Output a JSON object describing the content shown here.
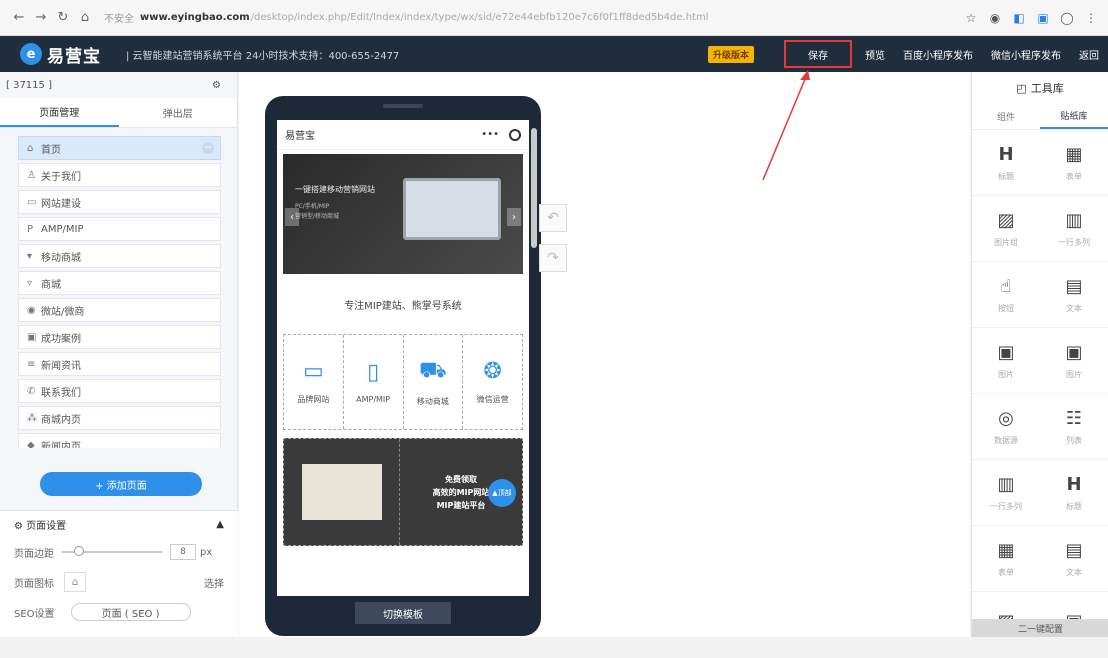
{
  "browser": {
    "security_label": "不安全",
    "host": "www.eyingbao.com",
    "path": "/desktop/index.php/Edit/Index/index/type/wx/sid/e72e44ebfb120e7c6f0f1ff8ded5b4de.html"
  },
  "header": {
    "logo_mark": "e",
    "logo_text": "易营宝",
    "slogan": "| 云智能建站营销系统平台 24小时技术支持：400-655-2477",
    "badge": "升级版本",
    "items": [
      "保存",
      "预览",
      "百度小程序发布",
      "微信小程序发布",
      "返回"
    ]
  },
  "left": {
    "site_id": "[ 37115 ]",
    "tabs": [
      "页面管理",
      "弹出层"
    ],
    "pages": [
      {
        "icon": "home-icon",
        "glyph": "⌂",
        "label": "首页"
      },
      {
        "icon": "about-icon",
        "glyph": "♙",
        "label": "关于我们"
      },
      {
        "icon": "site-icon",
        "glyph": "▭",
        "label": "网站建设"
      },
      {
        "icon": "amp-icon",
        "glyph": "P",
        "label": "AMP/MIP"
      },
      {
        "icon": "mobile-icon",
        "glyph": "▾",
        "label": "移动商城"
      },
      {
        "icon": "mall-icon",
        "glyph": "▿",
        "label": "商城"
      },
      {
        "icon": "wechat-icon",
        "glyph": "◉",
        "label": "微站/微商"
      },
      {
        "icon": "case-icon",
        "glyph": "▣",
        "label": "成功案例"
      },
      {
        "icon": "news-icon",
        "glyph": "≡",
        "label": "新闻资讯"
      },
      {
        "icon": "contact-icon",
        "glyph": "✆",
        "label": "联系我们"
      },
      {
        "icon": "grid-icon",
        "glyph": "⁂",
        "label": "商城内页"
      },
      {
        "icon": "inner-icon",
        "glyph": "◆",
        "label": "新闻内页"
      }
    ],
    "add_page": "+ 添加页面",
    "settings": {
      "title": "页面设置",
      "margin_label": "页面边距",
      "margin_value": "8",
      "margin_unit": "px",
      "icon_label": "页面图标",
      "icon_action": "选择",
      "seo_label": "SEO设置",
      "seo_value": "页面 ( SEO )"
    }
  },
  "phone": {
    "site_name": "易营宝",
    "banner_title": "一键搭建移动营销网站",
    "banner_sub": "PC/手机/MIP\n营销型/移动商城",
    "tagline": "专注MIP建站、熊掌号系统",
    "features": [
      {
        "glyph": "▭",
        "icon": "laptop-icon",
        "label": "品牌网站"
      },
      {
        "glyph": "▯",
        "icon": "phone-icon",
        "label": "AMP/MIP"
      },
      {
        "glyph": "⛟",
        "icon": "cart-icon",
        "label": "移动商城"
      },
      {
        "glyph": "❂",
        "icon": "wechat-icon",
        "label": "微信运营"
      }
    ],
    "promo_lines": [
      "免费领取",
      "高效的MIP网站",
      "MIP建站平台"
    ],
    "fab_label": "顶部",
    "switch_template": "切换模板"
  },
  "right": {
    "title": "工具库",
    "tabs": [
      "组件",
      "贴纸库"
    ],
    "widgets": [
      {
        "glyph": "H",
        "icon": "heading-icon",
        "label": "标题"
      },
      {
        "glyph": "▦",
        "icon": "form-icon",
        "label": "表单"
      },
      {
        "glyph": "▨",
        "icon": "image-group-icon",
        "label": "图片组"
      },
      {
        "glyph": "▥",
        "icon": "columns-icon",
        "label": "一行多列"
      },
      {
        "glyph": "☝",
        "icon": "click-icon",
        "label": "按钮"
      },
      {
        "glyph": "▤",
        "icon": "text-icon",
        "label": "文本"
      },
      {
        "glyph": "▣",
        "icon": "picture-icon",
        "label": "图片"
      },
      {
        "glyph": "▣",
        "icon": "picture-icon-2",
        "label": "图片"
      },
      {
        "glyph": "◎",
        "icon": "database-icon",
        "label": "数据源"
      },
      {
        "glyph": "☷",
        "icon": "list-icon",
        "label": "列表"
      },
      {
        "glyph": "▥",
        "icon": "columns-icon-2",
        "label": "一行多列"
      },
      {
        "glyph": "H",
        "icon": "heading-icon-2",
        "label": "标题"
      },
      {
        "glyph": "▦",
        "icon": "form-icon-2",
        "label": "表单"
      },
      {
        "glyph": "▤",
        "icon": "text-icon-2",
        "label": "文本"
      },
      {
        "glyph": "▨",
        "icon": "file-icon",
        "label": ""
      },
      {
        "glyph": "▣",
        "icon": "picture-icon-3",
        "label": ""
      }
    ],
    "footer": "二一键配置"
  },
  "colors": {
    "accent": "#2e90e8",
    "header_bg": "#1f2d3d",
    "annotation": "#e53935"
  }
}
